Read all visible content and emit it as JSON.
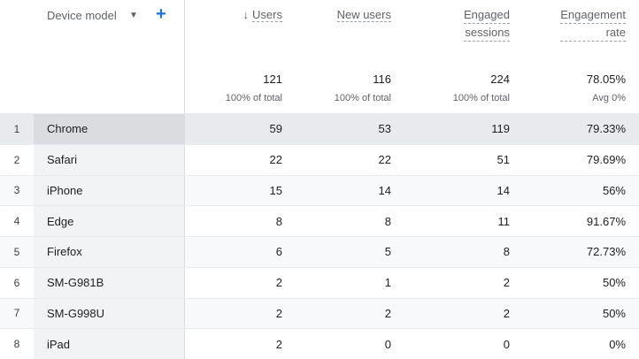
{
  "dimension": {
    "label": "Device model",
    "dropdown_icon": "caret-down-icon",
    "add_icon": "plus-icon"
  },
  "metrics": [
    {
      "title_line1": "Users",
      "title_line2": "",
      "total": "121",
      "sub": "100% of total",
      "sorted": true
    },
    {
      "title_line1": "New users",
      "title_line2": "",
      "total": "116",
      "sub": "100% of total",
      "sorted": false
    },
    {
      "title_line1": "Engaged",
      "title_line2": "sessions",
      "total": "224",
      "sub": "100% of total",
      "sorted": false
    },
    {
      "title_line1": "Engagement",
      "title_line2": "rate",
      "total": "78.05%",
      "sub": "Avg 0%",
      "sorted": false
    }
  ],
  "sort_icon": "arrow-down-icon",
  "rows": [
    {
      "index": "1",
      "name": "Chrome",
      "users": "59",
      "new_users": "53",
      "engaged_sessions": "119",
      "engagement_rate": "79.33%"
    },
    {
      "index": "2",
      "name": "Safari",
      "users": "22",
      "new_users": "22",
      "engaged_sessions": "51",
      "engagement_rate": "79.69%"
    },
    {
      "index": "3",
      "name": "iPhone",
      "users": "15",
      "new_users": "14",
      "engaged_sessions": "14",
      "engagement_rate": "56%"
    },
    {
      "index": "4",
      "name": "Edge",
      "users": "8",
      "new_users": "8",
      "engaged_sessions": "11",
      "engagement_rate": "91.67%"
    },
    {
      "index": "5",
      "name": "Firefox",
      "users": "6",
      "new_users": "5",
      "engaged_sessions": "8",
      "engagement_rate": "72.73%"
    },
    {
      "index": "6",
      "name": "SM-G981B",
      "users": "2",
      "new_users": "1",
      "engaged_sessions": "2",
      "engagement_rate": "50%"
    },
    {
      "index": "7",
      "name": "SM-G998U",
      "users": "2",
      "new_users": "2",
      "engaged_sessions": "2",
      "engagement_rate": "50%"
    },
    {
      "index": "8",
      "name": "iPad",
      "users": "2",
      "new_users": "0",
      "engaged_sessions": "0",
      "engagement_rate": "0%"
    }
  ],
  "colors": {
    "accent": "#1a73e8",
    "header_text": "#5f6368",
    "highlight_row": "#e8eaed",
    "dimension_cell": "#f1f3f4"
  }
}
